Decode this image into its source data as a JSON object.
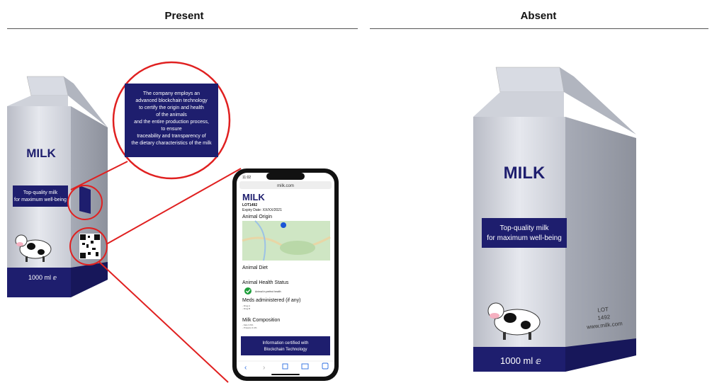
{
  "panels": {
    "present": {
      "title": "Present"
    },
    "absent": {
      "title": "Absent"
    }
  },
  "carton": {
    "brand": "MILK",
    "tagline_line1": "Top-quality milk",
    "tagline_line2": "for maximum well-being",
    "volume": "1000 ml ⅇ",
    "lot_line1": "LOT",
    "lot_line2": "1492",
    "website": "www.milk.com"
  },
  "callout": {
    "lines": [
      "The company employs an",
      "advanced blockchain technology",
      "to certify the origin and health",
      "of the animals",
      "and the entire production process,",
      "to ensure",
      "traceability and transparency of",
      "the dietary characteristics of the milk"
    ]
  },
  "phone": {
    "status_time": "11:02",
    "url": "milk.com",
    "product_title": "MILK",
    "lot": "LOT1492",
    "expiry": "Expiry Date: XX/XX/2021",
    "section_origin": "Animal Origin",
    "section_diet": "Animal Diet",
    "section_health": "Animal Health Status",
    "health_status_text": "Animal in perfect health",
    "section_meds": "Meds administered (if any)",
    "meds_items": [
      "- Drug A",
      "- Drug B"
    ],
    "section_composition": "Milk Composition",
    "composition_items": [
      "- Fats 3.6%",
      "- Proteins 3.4%"
    ],
    "certified_line1": "Information certified with",
    "certified_line2": "Blockchain Technology"
  },
  "colors": {
    "navy": "#1e1e6e",
    "callout_red": "#e02020",
    "carton_gray": "#c9ccd6",
    "check_green": "#1e9e3a"
  }
}
